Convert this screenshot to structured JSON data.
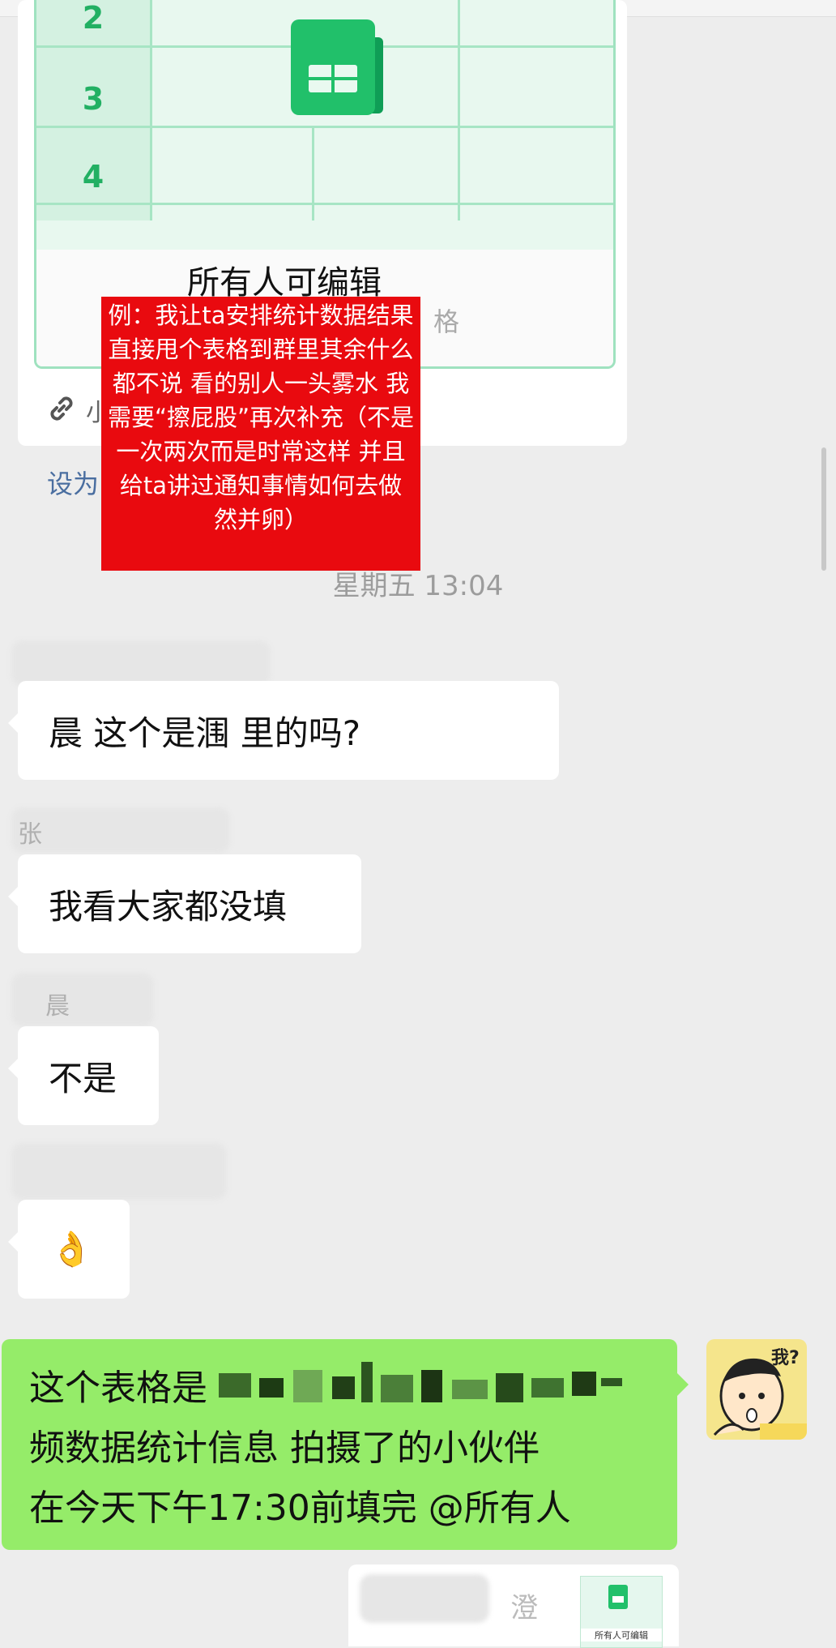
{
  "doc_card": {
    "row_numbers": [
      "2",
      "3",
      "4"
    ],
    "title": "所有人可编辑",
    "subtitle_fragment": "格",
    "footer_fragment": "小",
    "set_link": "设为"
  },
  "annotation": {
    "text": "例：我让ta安排统计数据结果直接甩个表格到群里其余什么都不说 看的别人一头雾水 我需要“擦屁股”再次补充（不是一次两次而是时常这样 并且给ta讲过通知事情如何去做 然并卵）"
  },
  "timestamp": "星期五 13:04",
  "messages": [
    {
      "sender": "",
      "text": "晨 这个是涠 里的吗?"
    },
    {
      "sender": "张",
      "text": "我看大家都没填"
    },
    {
      "sender": "晨",
      "text": "不是"
    },
    {
      "sender": "",
      "text": "👌"
    }
  ],
  "my_message": {
    "part1": "这个表格是",
    "part2": "频数据统计信息 拍摄了的小伙伴",
    "part3": "在今天下午17:30前填完 @所有人"
  },
  "avatar": {
    "caption": "我?"
  },
  "bottom_card": {
    "fragment": "澄",
    "mini_title": "所有人可编辑"
  },
  "colors": {
    "accent_green": "#95ec69",
    "annotation_red": "#e90a0f",
    "sheet_green": "#22b063"
  }
}
